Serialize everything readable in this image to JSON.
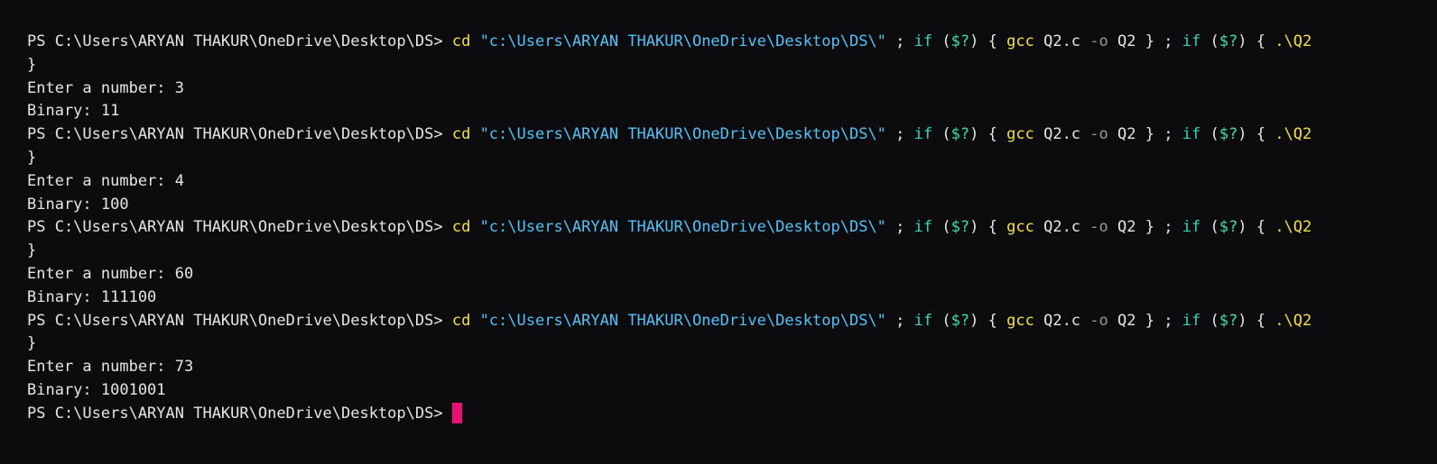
{
  "terminal": {
    "prompt": "PS C:\\Users\\ARYAN THAKUR\\OneDrive\\Desktop\\DS>",
    "command": {
      "cd": "cd",
      "path": "\"c:\\Users\\ARYAN THAKUR\\OneDrive\\Desktop\\DS\\\"",
      "semi": ";",
      "if": "if",
      "open_paren": "(",
      "status_var": "$?",
      "close_paren": ")",
      "open_brace": "{",
      "compiler": "gcc",
      "source": "Q2.c",
      "flag": "-o",
      "output": "Q2",
      "close_brace": "}",
      "exec": ".\\Q2",
      "continuation": "}"
    },
    "runs": [
      {
        "input_line": "Enter a number: 3",
        "output_line": "Binary: 11"
      },
      {
        "input_line": "Enter a number: 4",
        "output_line": "Binary: 100"
      },
      {
        "input_line": "Enter a number: 60",
        "output_line": "Binary: 111100"
      },
      {
        "input_line": "Enter a number: 73",
        "output_line": "Binary: 1001001"
      }
    ],
    "colors": {
      "background": "#0c0c0f",
      "text": "#d8d8d8",
      "command": "#f5e13c",
      "string": "#4fc3f7",
      "keyword": "#2fd9b0",
      "cursor": "#ee0e7a"
    }
  }
}
